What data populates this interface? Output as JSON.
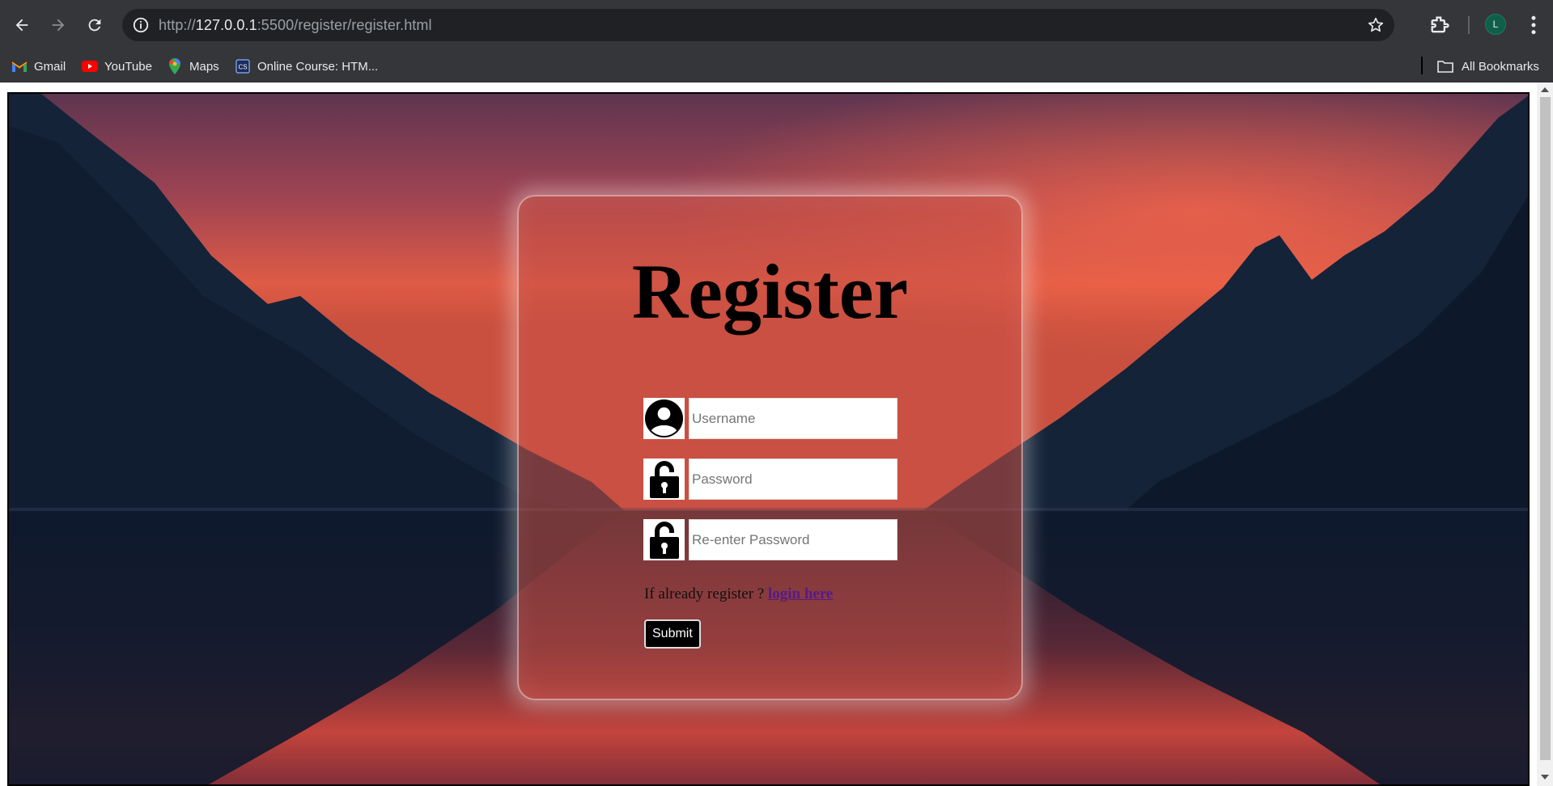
{
  "browser": {
    "url_scheme": "http://",
    "url_host": "127.0.0.1",
    "url_path": ":5500/register/register.html",
    "profile_initial": "L",
    "bookmarks": [
      {
        "label": "Gmail",
        "icon": "gmail-icon"
      },
      {
        "label": "YouTube",
        "icon": "youtube-icon"
      },
      {
        "label": "Maps",
        "icon": "maps-icon"
      },
      {
        "label": "Online Course: HTM...",
        "icon": "course-icon"
      }
    ],
    "all_bookmarks_label": "All Bookmarks"
  },
  "register": {
    "title": "Register",
    "username_placeholder": "Username",
    "password_placeholder": "Password",
    "reenter_placeholder": "Re-enter Password",
    "login_prompt": "If already register ? ",
    "login_link": "login here",
    "submit_label": "Submit"
  },
  "colors": {
    "chrome_bg": "#35363a",
    "omnibox_bg": "#202124",
    "link": "#551a8b",
    "button_bg": "#000000"
  }
}
